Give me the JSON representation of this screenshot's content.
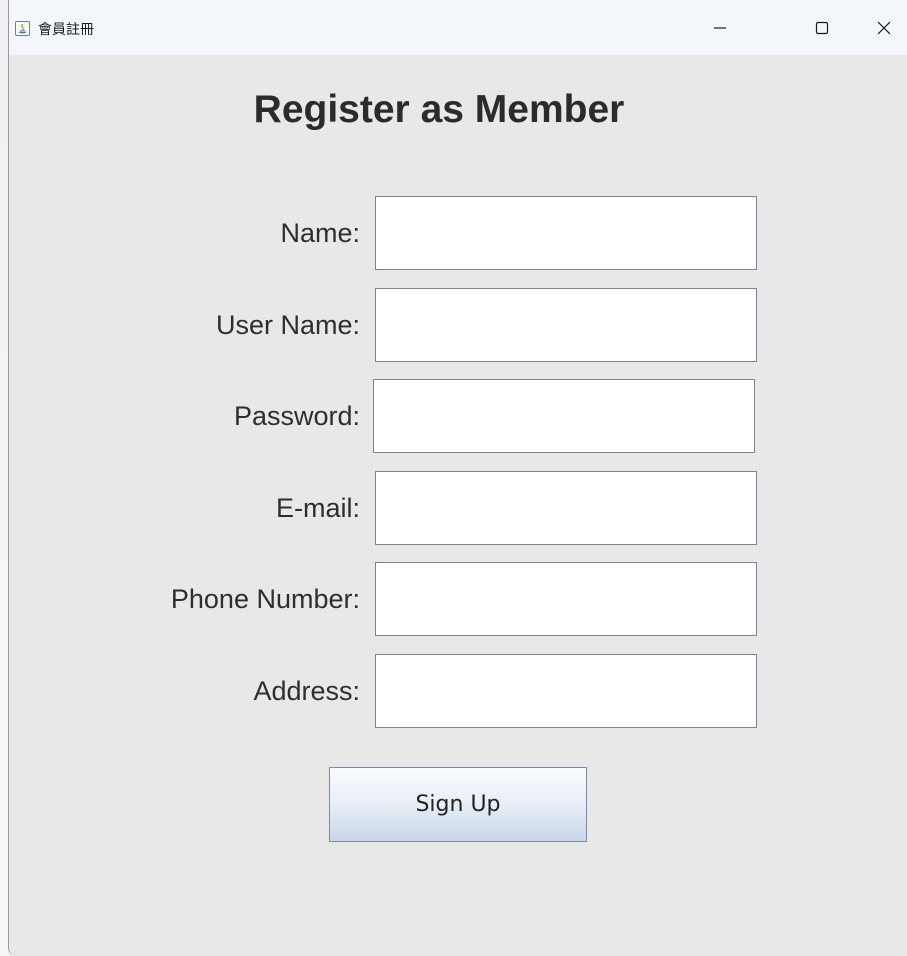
{
  "window": {
    "title": "會員註冊",
    "controls": {
      "minimize": "–",
      "maximize": "☐",
      "close": "✕"
    }
  },
  "form": {
    "heading": "Register as Member",
    "fields": [
      {
        "label": "Name:",
        "value": ""
      },
      {
        "label": "User Name:",
        "value": ""
      },
      {
        "label": "Password:",
        "value": ""
      },
      {
        "label": "E-mail:",
        "value": ""
      },
      {
        "label": "Phone Number:",
        "value": ""
      },
      {
        "label": "Address:",
        "value": ""
      }
    ],
    "submit_label": "Sign Up"
  }
}
